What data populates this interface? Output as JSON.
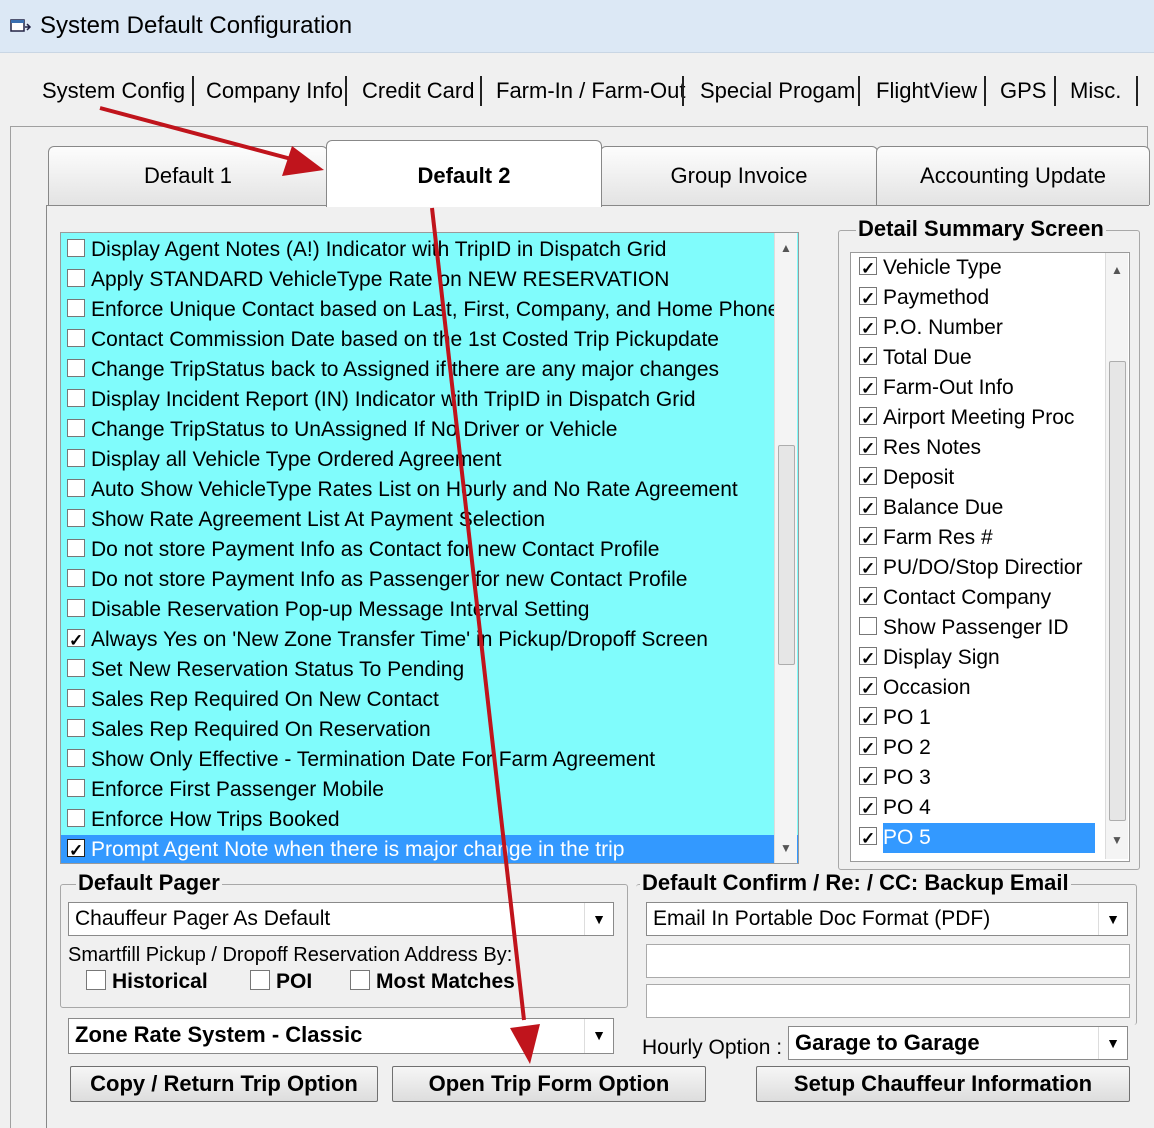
{
  "window": {
    "title": "System Default Configuration",
    "icon": "app-window-icon"
  },
  "outer_tabs": [
    "System Config",
    "Company Info",
    "Credit Card",
    "Farm-In / Farm-Out",
    "Special Progam",
    "FlightView",
    "GPS",
    "Misc."
  ],
  "inner_tabs": [
    "Default 1",
    "Default 2",
    "Group Invoice",
    "Accounting Update"
  ],
  "active_inner_tab": "Default 2",
  "options": [
    {
      "label": "Display  Agent Notes (A!) Indicator with TripID in Dispatch Grid",
      "checked": false
    },
    {
      "label": "Apply STANDARD VehicleType Rate on NEW RESERVATION",
      "checked": false
    },
    {
      "label": "Enforce Unique Contact based on Last, First, Company, and Home Phone",
      "checked": false
    },
    {
      "label": "Contact Commission Date based on the 1st Costed Trip Pickupdate",
      "checked": false
    },
    {
      "label": "Change TripStatus back to Assigned if there are any major changes",
      "checked": false
    },
    {
      "label": "Display Incident Report (IN) Indicator with TripID in Dispatch Grid",
      "checked": false
    },
    {
      "label": "Change TripStatus to UnAssigned If No Driver or Vehicle",
      "checked": false
    },
    {
      "label": "Display all Vehicle Type Ordered Agreement",
      "checked": false
    },
    {
      "label": "Auto Show VehicleType Rates List on Hourly and No Rate Agreement",
      "checked": false
    },
    {
      "label": "Show Rate Agreement List At Payment Selection",
      "checked": false
    },
    {
      "label": "Do not store Payment Info as Contact for new Contact Profile",
      "checked": false
    },
    {
      "label": "Do not store Payment Info as Passenger for new Contact Profile",
      "checked": false
    },
    {
      "label": "Disable Reservation Pop-up Message Interval Setting",
      "checked": false
    },
    {
      "label": "Always Yes on 'New Zone Transfer Time' in Pickup/Dropoff Screen",
      "checked": true
    },
    {
      "label": "Set New Reservation Status To Pending",
      "checked": false
    },
    {
      "label": "Sales Rep Required On New Contact",
      "checked": false
    },
    {
      "label": "Sales Rep Required On Reservation",
      "checked": false
    },
    {
      "label": "Show Only Effective - Termination Date For Farm Agreement",
      "checked": false
    },
    {
      "label": "Enforce First Passenger Mobile",
      "checked": false
    },
    {
      "label": "Enforce How Trips Booked",
      "checked": false
    },
    {
      "label": "Prompt Agent Note when there is major change in the trip",
      "checked": true,
      "selected": true
    }
  ],
  "detail_summary": {
    "title": "Detail Summary Screen",
    "items": [
      {
        "label": "Vehicle Type",
        "checked": true
      },
      {
        "label": "Paymethod",
        "checked": true
      },
      {
        "label": "P.O. Number",
        "checked": true
      },
      {
        "label": "Total Due",
        "checked": true
      },
      {
        "label": "Farm-Out Info",
        "checked": true
      },
      {
        "label": "Airport Meeting Proc",
        "checked": true
      },
      {
        "label": "Res Notes",
        "checked": true
      },
      {
        "label": "Deposit",
        "checked": true
      },
      {
        "label": "Balance Due",
        "checked": true
      },
      {
        "label": "Farm Res #",
        "checked": true
      },
      {
        "label": "PU/DO/Stop Directior",
        "checked": true
      },
      {
        "label": "Contact Company",
        "checked": true
      },
      {
        "label": "Show Passenger ID",
        "checked": false
      },
      {
        "label": "Display Sign",
        "checked": true
      },
      {
        "label": "Occasion",
        "checked": true
      },
      {
        "label": "PO 1",
        "checked": true
      },
      {
        "label": "PO 2",
        "checked": true
      },
      {
        "label": "PO 3",
        "checked": true
      },
      {
        "label": "PO 4",
        "checked": true
      },
      {
        "label": "PO 5",
        "checked": true,
        "selected": true
      }
    ]
  },
  "default_pager": {
    "title": "Default Pager",
    "value": "Chauffeur Pager As Default",
    "smartfill_label": "Smartfill Pickup / Dropoff Reservation Address By:",
    "smartfill_options": [
      {
        "label": "Historical",
        "checked": false
      },
      {
        "label": "POI",
        "checked": false
      },
      {
        "label": "Most Matches",
        "checked": false
      }
    ],
    "zone_rate": "Zone Rate System - Classic"
  },
  "backup_email": {
    "title": "Default Confirm / Re: / CC: Backup Email",
    "format": "Email In Portable Doc Format (PDF)",
    "email1": "",
    "email2": "",
    "hourly_label": "Hourly Option :",
    "hourly_value": "Garage to Garage"
  },
  "buttons": {
    "copy_return": "Copy / Return Trip Option",
    "open_trip": "Open Trip Form Option",
    "setup_chauffeur": "Setup Chauffeur Information"
  },
  "colors": {
    "options_bg": "#80fcfc",
    "selection": "#3399ff",
    "annotation_arrow": "#c0141c"
  }
}
